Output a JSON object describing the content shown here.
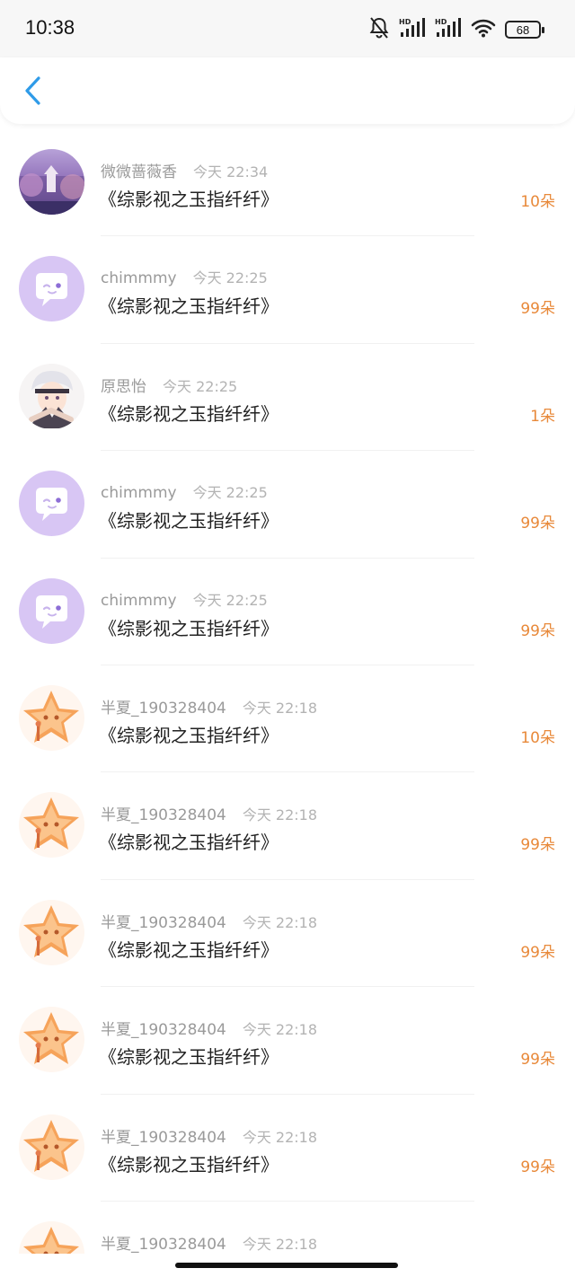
{
  "status_bar": {
    "time": "10:38",
    "battery": "68",
    "icons": [
      "bell-muted-icon",
      "signal-hd-icon",
      "signal-hd-icon",
      "wifi-icon",
      "battery-icon"
    ]
  },
  "nav": {
    "back_icon": "chevron-left-icon",
    "accent": "#2f9be8"
  },
  "colors": {
    "count": "#e8893a",
    "meta": "#9a9a9a"
  },
  "records": [
    {
      "user": "微微蔷薇香",
      "time": "今天 22:34",
      "title": "《综影视之玉指纤纤》",
      "count": "10朵",
      "avatar": "landscape"
    },
    {
      "user": "chimmmy",
      "time": "今天 22:25",
      "title": "《综影视之玉指纤纤》",
      "count": "99朵",
      "avatar": "default"
    },
    {
      "user": "原思怡",
      "time": "今天 22:25",
      "title": "《综影视之玉指纤纤》",
      "count": "1朵",
      "avatar": "anime"
    },
    {
      "user": "chimmmy",
      "time": "今天 22:25",
      "title": "《综影视之玉指纤纤》",
      "count": "99朵",
      "avatar": "default"
    },
    {
      "user": "chimmmy",
      "time": "今天 22:25",
      "title": "《综影视之玉指纤纤》",
      "count": "99朵",
      "avatar": "default"
    },
    {
      "user": "半夏_190328404",
      "time": "今天 22:18",
      "title": "《综影视之玉指纤纤》",
      "count": "10朵",
      "avatar": "star"
    },
    {
      "user": "半夏_190328404",
      "time": "今天 22:18",
      "title": "《综影视之玉指纤纤》",
      "count": "99朵",
      "avatar": "star"
    },
    {
      "user": "半夏_190328404",
      "time": "今天 22:18",
      "title": "《综影视之玉指纤纤》",
      "count": "99朵",
      "avatar": "star"
    },
    {
      "user": "半夏_190328404",
      "time": "今天 22:18",
      "title": "《综影视之玉指纤纤》",
      "count": "99朵",
      "avatar": "star"
    },
    {
      "user": "半夏_190328404",
      "time": "今天 22:18",
      "title": "《综影视之玉指纤纤》",
      "count": "99朵",
      "avatar": "star"
    },
    {
      "user": "半夏_190328404",
      "time": "今天 22:18",
      "title": "",
      "count": "",
      "avatar": "star"
    }
  ]
}
